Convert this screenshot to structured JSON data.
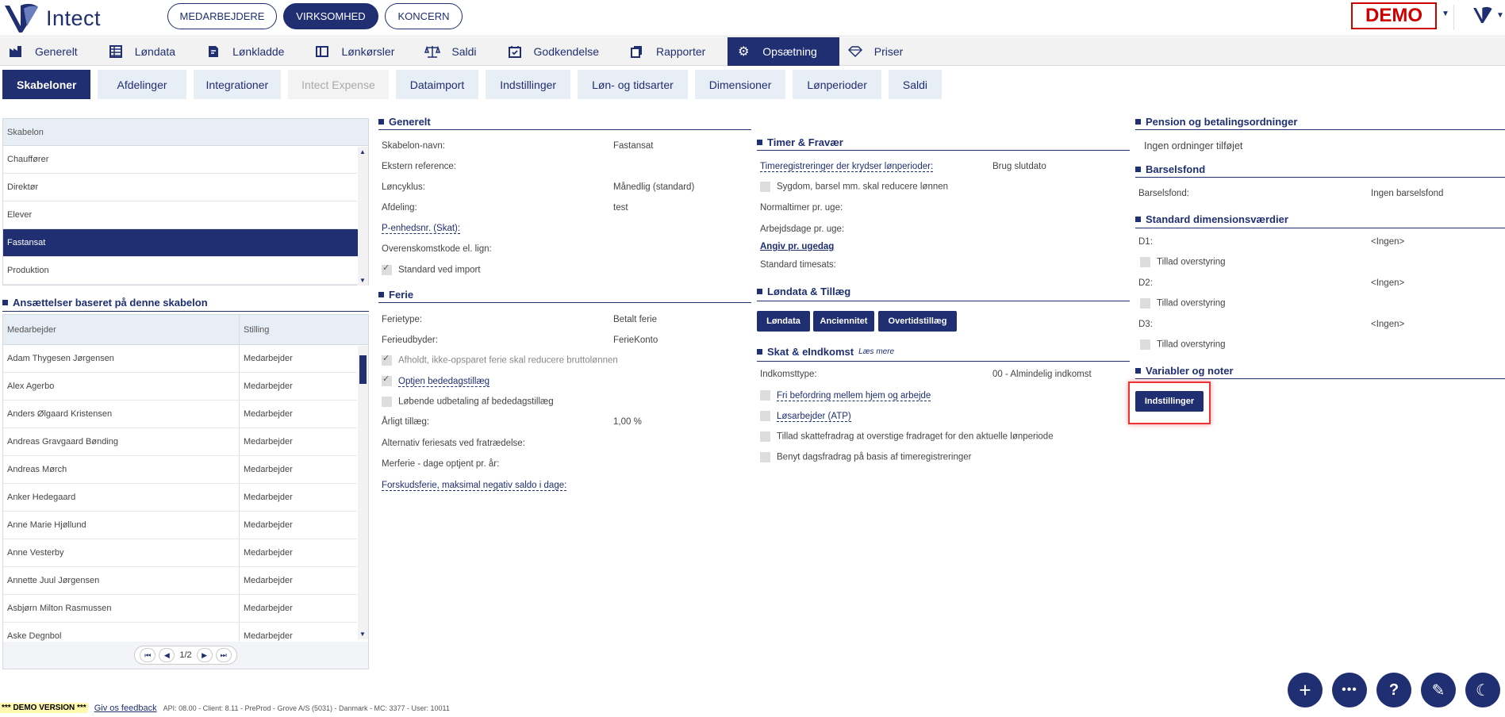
{
  "app": {
    "name": "Intect",
    "demo_badge": "DEMO"
  },
  "context_pills": [
    {
      "label": "MEDARBEJDERE",
      "active": false
    },
    {
      "label": "VIRKSOMHED",
      "active": true
    },
    {
      "label": "KONCERN",
      "active": false
    }
  ],
  "main_nav": [
    {
      "label": "Generelt",
      "icon": "factory-icon",
      "active": false
    },
    {
      "label": "Løndata",
      "icon": "grid-icon",
      "active": false
    },
    {
      "label": "Lønkladde",
      "icon": "edit-doc-icon",
      "active": false
    },
    {
      "label": "Lønkørsler",
      "icon": "columns-icon",
      "active": false
    },
    {
      "label": "Saldi",
      "icon": "scale-icon",
      "active": false
    },
    {
      "label": "Godkendelse",
      "icon": "calendar-check-icon",
      "active": false
    },
    {
      "label": "Rapporter",
      "icon": "copy-icon",
      "active": false
    },
    {
      "label": "Opsætning",
      "icon": "gear-icon",
      "active": true
    },
    {
      "label": "Priser",
      "icon": "diamond-icon",
      "active": false
    }
  ],
  "sub_nav": [
    {
      "label": "Skabeloner",
      "state": "active"
    },
    {
      "label": "Afdelinger",
      "state": "normal"
    },
    {
      "label": "Integrationer",
      "state": "normal"
    },
    {
      "label": "Intect Expense",
      "state": "disabled"
    },
    {
      "label": "Dataimport",
      "state": "normal"
    },
    {
      "label": "Indstillinger",
      "state": "normal"
    },
    {
      "label": "Løn- og tidsarter",
      "state": "normal"
    },
    {
      "label": "Dimensioner",
      "state": "normal"
    },
    {
      "label": "Lønperioder",
      "state": "normal"
    },
    {
      "label": "Saldi",
      "state": "normal"
    }
  ],
  "templates": {
    "header": "Skabelon",
    "items": [
      {
        "label": "Chauffører",
        "active": false
      },
      {
        "label": "Direktør",
        "active": false
      },
      {
        "label": "Elever",
        "active": false
      },
      {
        "label": "Fastansat",
        "active": true
      },
      {
        "label": "Produktion",
        "active": false
      }
    ]
  },
  "employments": {
    "title": "Ansættelser baseret på denne skabelon",
    "col_employee": "Medarbejder",
    "col_position": "Stilling",
    "rows": [
      {
        "name": "Adam Thygesen Jørgensen",
        "position": "Medarbejder"
      },
      {
        "name": "Alex Agerbo",
        "position": "Medarbejder"
      },
      {
        "name": "Anders Ølgaard Kristensen",
        "position": "Medarbejder"
      },
      {
        "name": "Andreas Gravgaard Bønding",
        "position": "Medarbejder"
      },
      {
        "name": "Andreas Mørch",
        "position": "Medarbejder"
      },
      {
        "name": "Anker Hedegaard",
        "position": "Medarbejder"
      },
      {
        "name": "Anne Marie Hjøllund",
        "position": "Medarbejder"
      },
      {
        "name": "Anne Vesterby",
        "position": "Medarbejder"
      },
      {
        "name": "Annette Juul Jørgensen",
        "position": "Medarbejder"
      },
      {
        "name": "Asbjørn Milton Rasmussen",
        "position": "Medarbejder"
      },
      {
        "name": "Aske Degnbol",
        "position": "Medarbejder"
      }
    ],
    "pager": "1/2"
  },
  "generelt": {
    "title": "Generelt",
    "name_label": "Skabelon-navn:",
    "name_value": "Fastansat",
    "extref_label": "Ekstern reference:",
    "cycle_label": "Løncyklus:",
    "cycle_value": "Månedlig (standard)",
    "dept_label": "Afdeling:",
    "dept_value": "test",
    "punit_label": "P-enhedsnr. (Skat):",
    "agreement_label": "Overenskomstkode el. lign:",
    "std_import_label": "Standard ved import"
  },
  "ferie": {
    "title": "Ferie",
    "type_label": "Ferietype:",
    "type_value": "Betalt ferie",
    "provider_label": "Ferieudbyder:",
    "provider_value": "FerieKonto",
    "reduce_label": "Afholdt, ikke-opsparet ferie skal reducere bruttolønnen",
    "optjen_label": "Optjen bededagstillæg",
    "lobende_label": "Løbende udbetaling af bededagstillæg",
    "yearly_label": "Årligt tillæg:",
    "yearly_value": "1,00 %",
    "altrate_label": "Alternativ feriesats ved fratrædelse:",
    "merferie_label": "Merferie - dage optjent pr. år:",
    "forskud_label": "Forskudsferie, maksimal negativ saldo i dage:"
  },
  "timer": {
    "title": "Timer & Fravær",
    "cross_label": "Timeregistreringer der krydser lønperioder:",
    "cross_value": "Brug slutdato",
    "sick_label": "Sygdom, barsel mm. skal reducere lønnen",
    "normal_label": "Normaltimer pr. uge:",
    "workdays_label": "Arbejdsdage pr. uge:",
    "per_weekday_link": "Angiv pr. ugedag",
    "std_rate_label": "Standard timesats:"
  },
  "londata": {
    "title": "Løndata & Tillæg",
    "buttons": [
      "Løndata",
      "Anciennitet",
      "Overtidstillæg"
    ]
  },
  "skat": {
    "title": "Skat & eIndkomst",
    "learn_more": "Læs mere",
    "income_label": "Indkomsttype:",
    "income_value": "00 - Almindelig indkomst",
    "fri_label": "Fri befordring mellem hjem og arbejde",
    "los_label": "Løsarbejder (ATP)",
    "tillad_label": "Tillad skattefradrag at overstige fradraget for den aktuelle lønperiode",
    "benyt_label": "Benyt dagsfradrag på basis af timeregistreringer"
  },
  "pension": {
    "title": "Pension og betalingsordninger",
    "empty": "Ingen ordninger tilføjet"
  },
  "barsel": {
    "title": "Barselsfond",
    "label": "Barselsfond:",
    "value": "Ingen barselsfond"
  },
  "dims": {
    "title": "Standard dimensionsværdier",
    "items": [
      {
        "label": "D1:",
        "value": "<Ingen>",
        "override": "Tillad overstyring"
      },
      {
        "label": "D2:",
        "value": "<Ingen>",
        "override": "Tillad overstyring"
      },
      {
        "label": "D3:",
        "value": "<Ingen>",
        "override": "Tillad overstyring"
      }
    ]
  },
  "variables": {
    "title": "Variabler og noter",
    "button": "Indstillinger"
  },
  "footer": {
    "demo": "*** DEMO VERSION ***",
    "feedback": "Giv os feedback",
    "meta": "API: 08.00 - Client: 8.11 - PreProd  -  Grove A/S (5031) - Danmark - MC: 3377  -  User: 10011"
  }
}
